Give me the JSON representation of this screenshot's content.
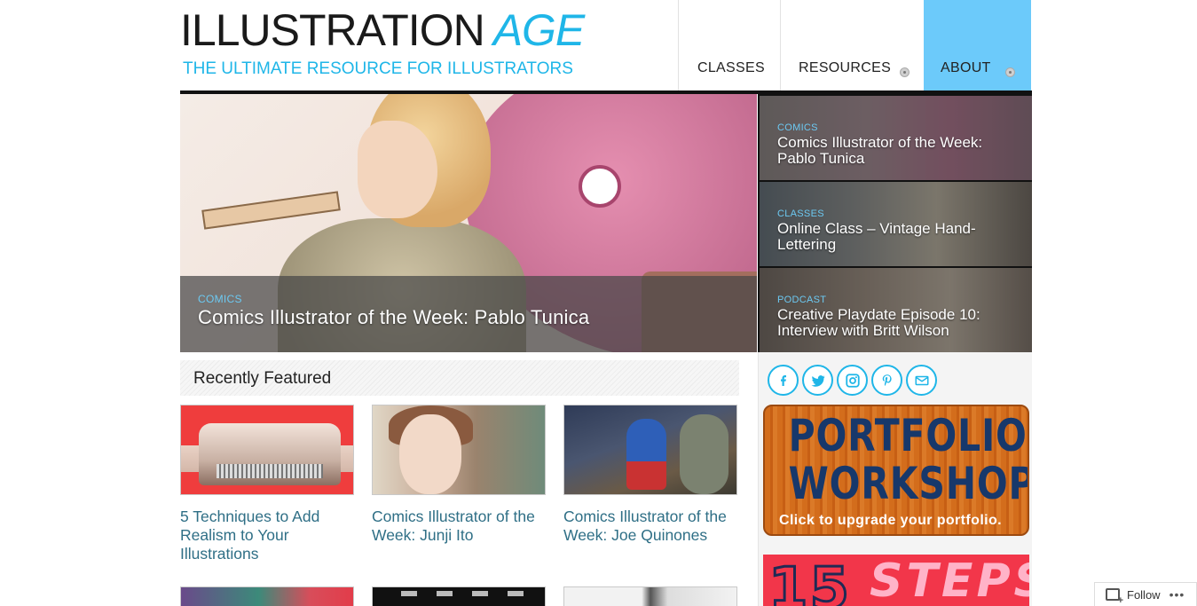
{
  "header": {
    "logo_word1": "ILLUSTRATION",
    "logo_word2": "AGE",
    "tagline": "THE ULTIMATE RESOURCE FOR ILLUSTRATORS",
    "accent_color": "#1fb6e8"
  },
  "nav": {
    "items": [
      {
        "label": "CLASSES",
        "has_dropdown": false
      },
      {
        "label": "RESOURCES",
        "has_dropdown": true
      },
      {
        "label": "ABOUT",
        "has_dropdown": true,
        "active": true
      }
    ],
    "active_bg_color": "#6ccafa"
  },
  "hero": {
    "category": "COMICS",
    "title": "Comics Illustrator of the Week: Pablo Tunica"
  },
  "slides": [
    {
      "category": "COMICS",
      "title": "Comics Illustrator of the Week: Pablo Tunica"
    },
    {
      "category": "CLASSES",
      "title": "Online Class – Vintage Hand-Lettering"
    },
    {
      "category": "PODCAST",
      "title": "Creative Playdate Episode 10: Interview with Britt Wilson"
    }
  ],
  "recently_featured": {
    "heading": "Recently Featured",
    "cards": [
      {
        "title": "5 Techniques to Add Realism to Your Illustrations"
      },
      {
        "title": "Comics Illustrator of the Week: Junji Ito"
      },
      {
        "title": "Comics Illustrator of the Week: Joe Quinones"
      }
    ]
  },
  "sidebar": {
    "social_icons": [
      "facebook-icon",
      "twitter-icon",
      "instagram-icon",
      "pinterest-icon",
      "email-icon"
    ],
    "portfolio_ad": {
      "line1": "PORTFOLIO",
      "line2": "WORKSHOP",
      "line3": "Click to upgrade your portfolio."
    },
    "steps_ad": {
      "number": "15",
      "word": "STEPS"
    }
  },
  "follow_widget": {
    "label": "Follow",
    "more": "•••"
  }
}
